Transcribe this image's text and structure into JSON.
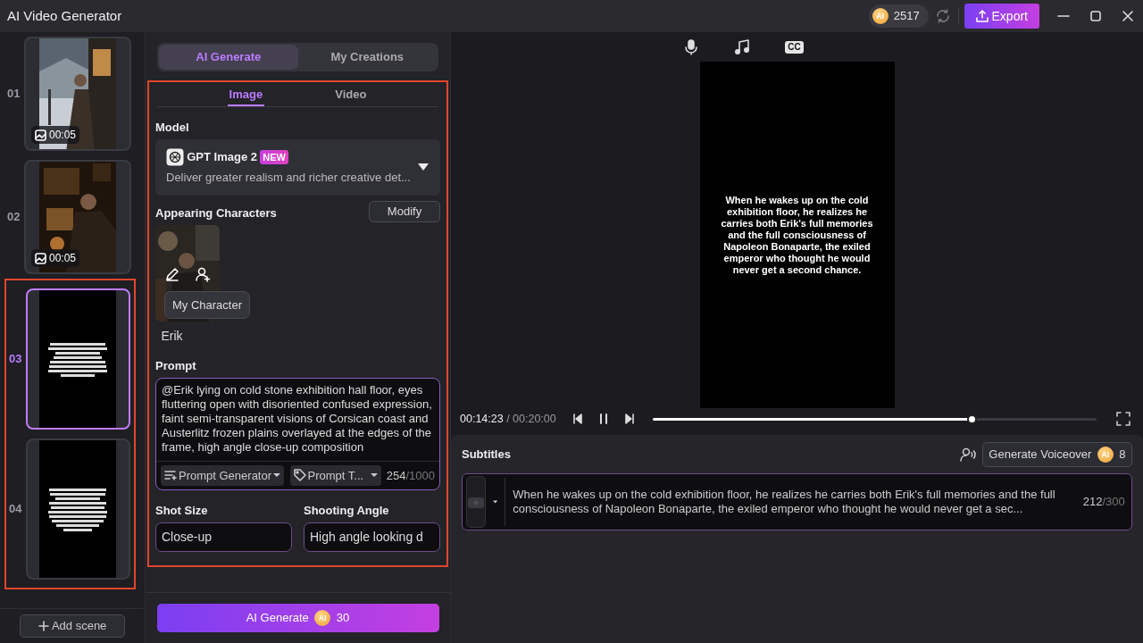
{
  "window": {
    "title": "AI Video Generator"
  },
  "header": {
    "coin": "AI",
    "credits": "2517",
    "export_label": "Export"
  },
  "scenes": [
    {
      "number": "01",
      "kind": "picture",
      "selected": false,
      "duration": "00:05"
    },
    {
      "number": "02",
      "kind": "picture",
      "selected": false,
      "duration": "00:05"
    },
    {
      "number": "03",
      "kind": "caption",
      "selected": true
    },
    {
      "number": "04",
      "kind": "caption",
      "selected": false
    }
  ],
  "add_scene": "Add scene",
  "mode_tabs": [
    {
      "label": "AI Generate",
      "selected": true
    },
    {
      "label": "My Creations",
      "selected": false
    }
  ],
  "media_tabs": [
    {
      "label": "Image",
      "selected": true
    },
    {
      "label": "Video",
      "selected": false
    }
  ],
  "model": {
    "label": "Model",
    "name": "GPT Image 2",
    "badge": "NEW",
    "description": "Deliver greater realism and richer creative det..."
  },
  "characters": {
    "label": "Appearing Characters",
    "modify": "Modify",
    "items": [
      {
        "name": "Erik",
        "tooltip": "My Character"
      }
    ]
  },
  "prompt": {
    "label": "Prompt",
    "value": "@Erik lying on cold stone exhibition hall floor, eyes fluttering open with disoriented confused expression, faint semi-transparent visions of Corsican coast and Austerlitz frozen plains overlayed at the edges of the frame, high angle close-up composition",
    "generator": "Prompt Generator",
    "template": "Prompt T...",
    "count": "254",
    "max": "/1000"
  },
  "shot_size": {
    "label": "Shot Size",
    "value": "Close-up"
  },
  "shooting_angle": {
    "label": "Shooting Angle",
    "value": "High angle looking d"
  },
  "generate": {
    "label": "AI Generate",
    "coin": "AI",
    "cost": "30"
  },
  "toolbar": [
    {
      "kind": "voice"
    },
    {
      "kind": "music"
    },
    {
      "kind": "captions",
      "label": "CC"
    }
  ],
  "preview": {
    "caption": "When he wakes up on the cold exhibition floor, he realizes he carries both Erik's full memories and the full consciousness of Napoleon Bonaparte, the exiled emperor who thought he would never get a second chance.",
    "current_time": "00:14:23",
    "total_time": "/ 00:20:00",
    "level": 0.72
  },
  "subtitles": {
    "title": "Subtitles",
    "voiceover": "Generate Voiceover",
    "coin": "AI",
    "cost": "8",
    "text": "When he wakes up on the cold exhibition floor, he realizes he carries both Erik's full memories and the full consciousness of Napoleon Bonaparte, the exiled emperor who thought he would never get a sec...",
    "count": "212",
    "max": "/300"
  }
}
